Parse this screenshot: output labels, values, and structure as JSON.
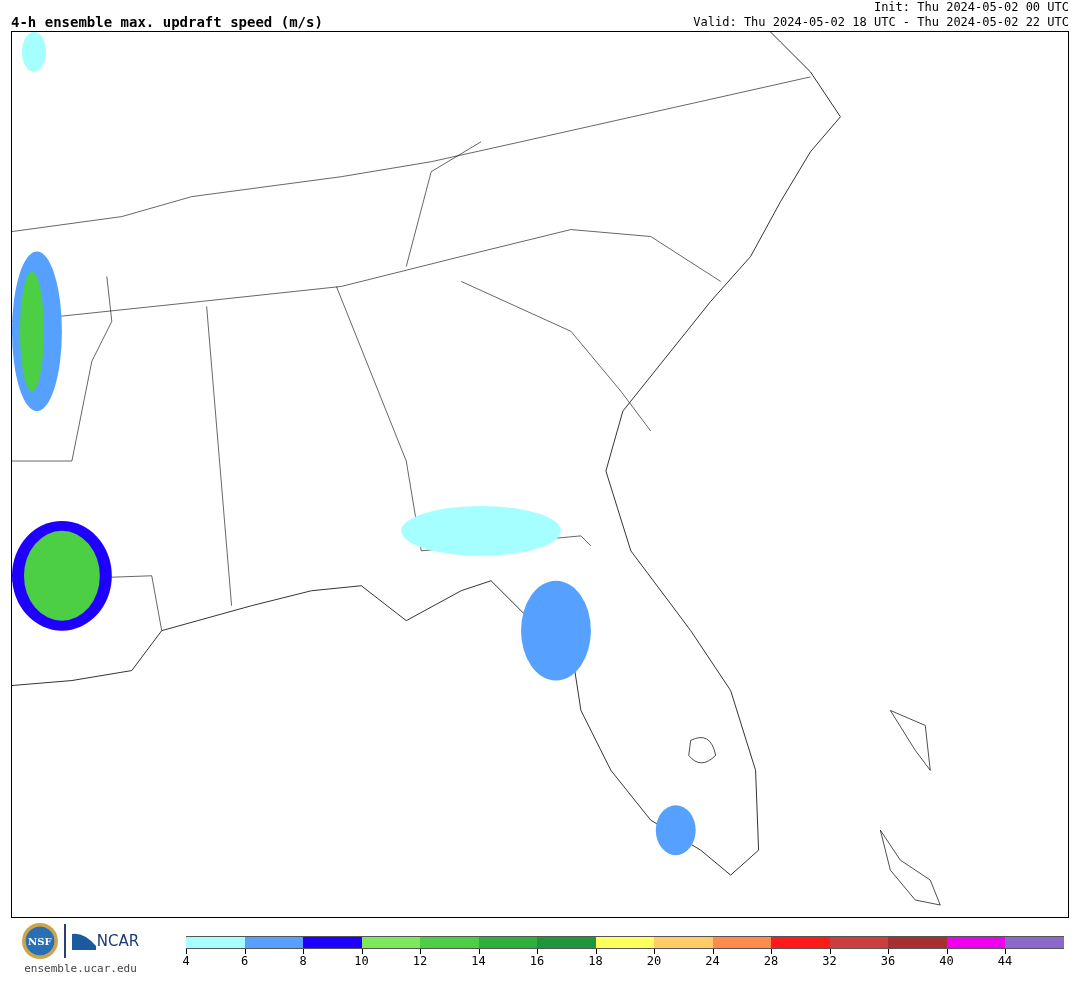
{
  "header": {
    "title": "4-h ensemble max. updraft speed (m/s)",
    "init": "Init: Thu 2024-05-02 00 UTC",
    "valid": "Valid: Thu 2024-05-02 18 UTC - Thu 2024-05-02 22 UTC"
  },
  "footer": {
    "nsf_logo": "NSF",
    "ncar_logo": "NCAR",
    "url": "ensemble.ucar.edu"
  },
  "colorbar": {
    "segments": [
      {
        "color": "#a6ffff",
        "tick": "4"
      },
      {
        "color": "#56a1ff",
        "tick": "6"
      },
      {
        "color": "#1f00ff",
        "tick": "8"
      },
      {
        "color": "#7de85b",
        "tick": "10"
      },
      {
        "color": "#4ccf44",
        "tick": "12"
      },
      {
        "color": "#2eb13c",
        "tick": "14"
      },
      {
        "color": "#1f963a",
        "tick": "16"
      },
      {
        "color": "#ffff5e",
        "tick": "18"
      },
      {
        "color": "#ffcc68",
        "tick": "20"
      },
      {
        "color": "#ff8a4d",
        "tick": "24"
      },
      {
        "color": "#ff1a1a",
        "tick": "28"
      },
      {
        "color": "#cc3d3d",
        "tick": "32"
      },
      {
        "color": "#a62f2f",
        "tick": "36"
      },
      {
        "color": "#ee00ee",
        "tick": "40"
      },
      {
        "color": "#8b68cc",
        "tick": "44"
      }
    ]
  }
}
